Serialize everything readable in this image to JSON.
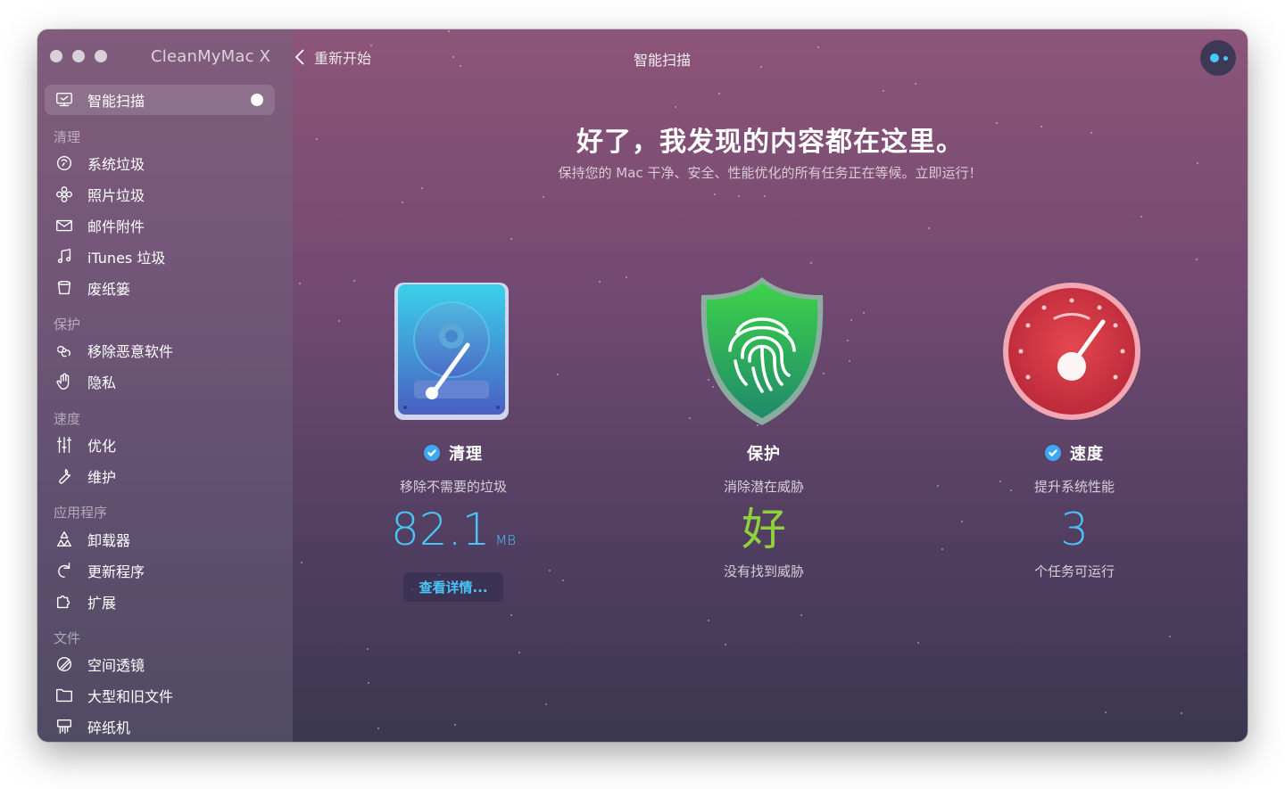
{
  "app": {
    "title": "CleanMyMac X"
  },
  "toolbar": {
    "back_label": "重新开始",
    "title": "智能扫描"
  },
  "sidebar": {
    "active": "智能扫描",
    "sections": {
      "clean": "清理",
      "protect": "保护",
      "speed": "速度",
      "apps": "应用程序",
      "files": "文件"
    },
    "items": {
      "smart_scan": "智能扫描",
      "system_junk": "系统垃圾",
      "photo_junk": "照片垃圾",
      "mail_attachments": "邮件附件",
      "itunes_junk": "iTunes 垃圾",
      "trash_bins": "废纸篓",
      "malware_removal": "移除恶意软件",
      "privacy": "隐私",
      "optimization": "优化",
      "maintenance": "维护",
      "uninstaller": "卸载器",
      "updater": "更新程序",
      "extensions": "扩展",
      "space_lens": "空间透镜",
      "large_old_files": "大型和旧文件",
      "shredder": "碎纸机"
    }
  },
  "main": {
    "headline": "好了，我发现的内容都在这里。",
    "subline": "保持您的 Mac 干净、安全、性能优化的所有任务正在等候。立即运行！",
    "cleanup": {
      "title": "清理",
      "desc": "移除不需要的垃圾",
      "value": "82.1",
      "unit": "MB",
      "button": "查看详情...",
      "checked": true
    },
    "protection": {
      "title": "保护",
      "desc": "消除潜在威胁",
      "value": "好",
      "status": "没有找到威胁",
      "checked": false
    },
    "speed": {
      "title": "速度",
      "desc": "提升系统性能",
      "value": "3",
      "status": "个任务可运行",
      "checked": true
    }
  },
  "colors": {
    "accent_blue": "#3aa9f3",
    "value_blue": "#49c4f6",
    "value_green": "#8fd13b",
    "bg_top": "#8d5579",
    "bg_bottom": "#3b3750"
  },
  "icons": {
    "cleanup": "hard-drive-gauge-icon",
    "protection": "fingerprint-shield-icon",
    "speed": "speedometer-icon",
    "assistant": "assistant-face-icon"
  }
}
